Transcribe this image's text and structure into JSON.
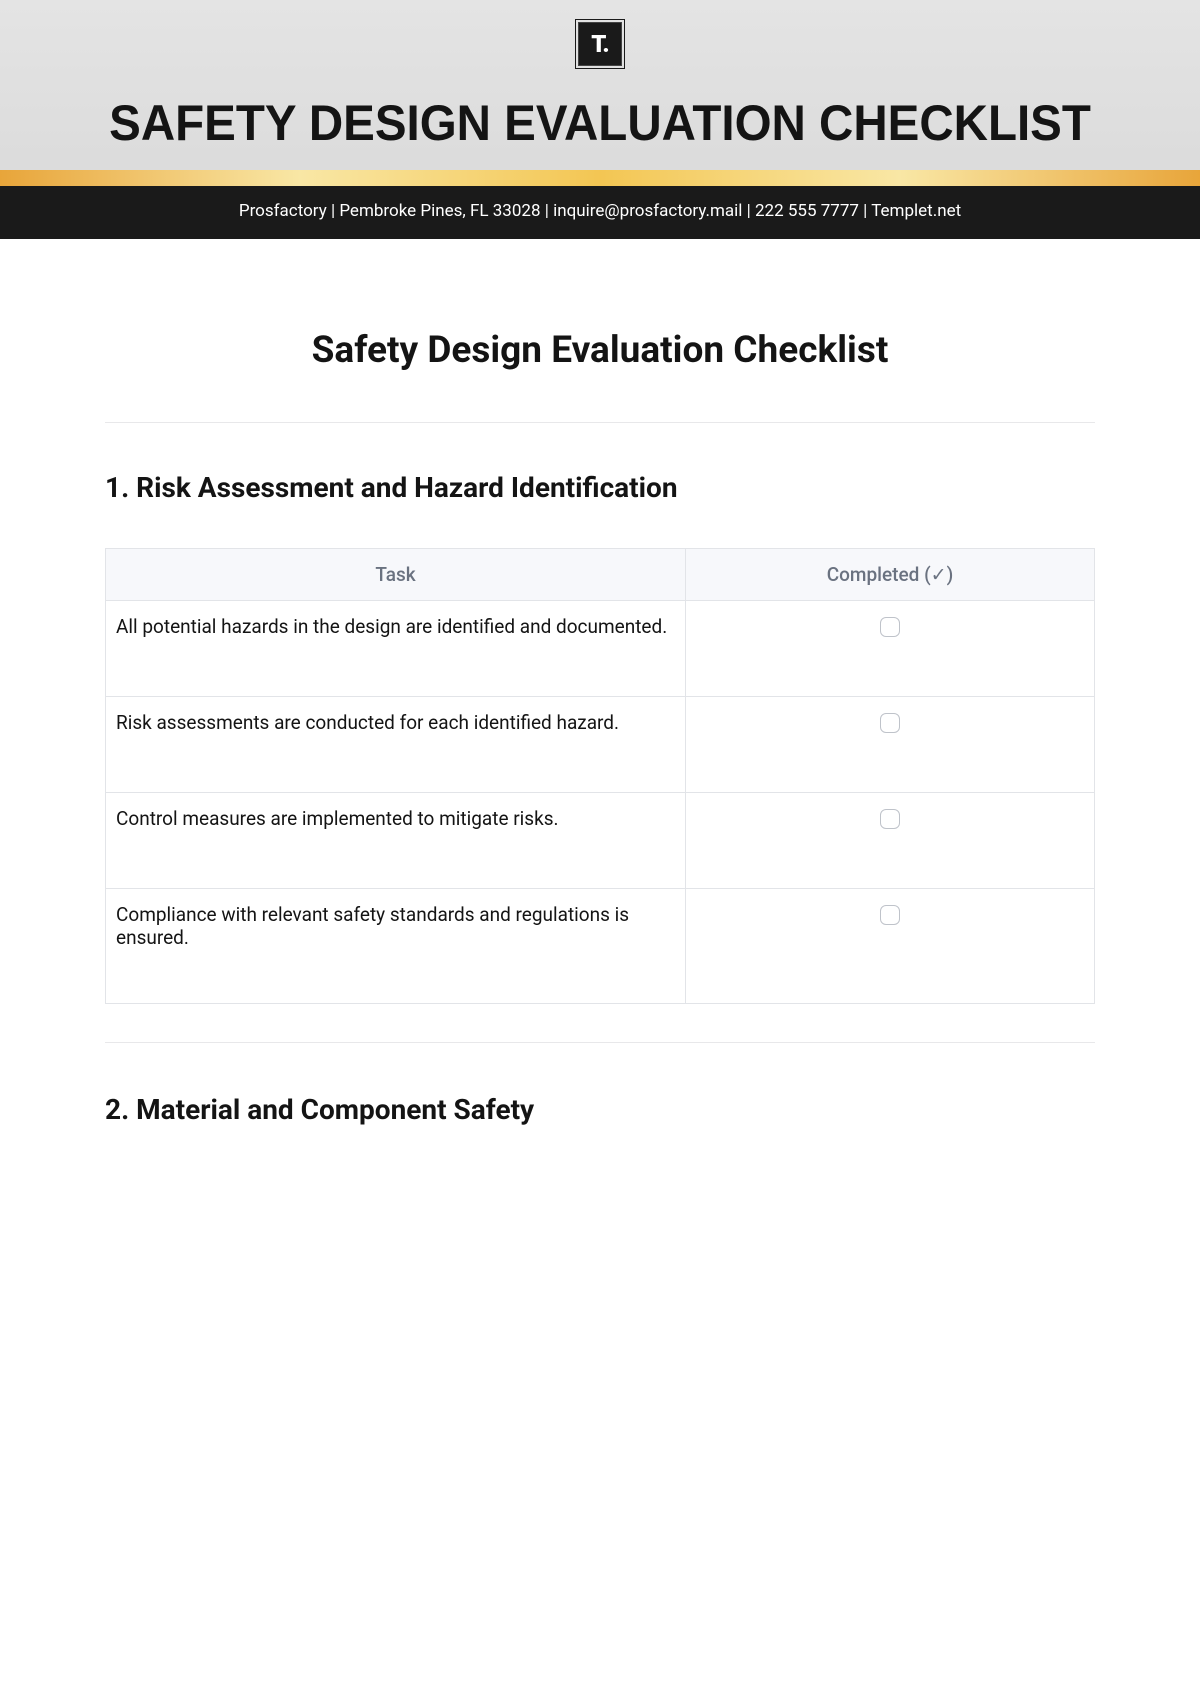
{
  "header": {
    "logo_text": "T.",
    "main_title": "SAFETY DESIGN EVALUATION CHECKLIST",
    "info_line": "Prosfactory  |  Pembroke Pines, FL 33028 |  inquire@prosfactory.mail | 222 555 7777 | Templet.net"
  },
  "doc": {
    "heading": "Safety Design Evaluation Checklist",
    "table_headers": {
      "task": "Task",
      "completed": "Completed (✓)"
    },
    "sections": [
      {
        "title": "1. Risk Assessment and Hazard Identification",
        "rows": [
          {
            "task": "All potential hazards in the design are identified and documented."
          },
          {
            "task": "Risk assessments are conducted for each identified hazard."
          },
          {
            "task": "Control measures are implemented to mitigate risks."
          },
          {
            "task": "Compliance with relevant safety standards and regulations is ensured."
          }
        ]
      },
      {
        "title": "2. Material and Component Safety",
        "rows": []
      }
    ]
  }
}
